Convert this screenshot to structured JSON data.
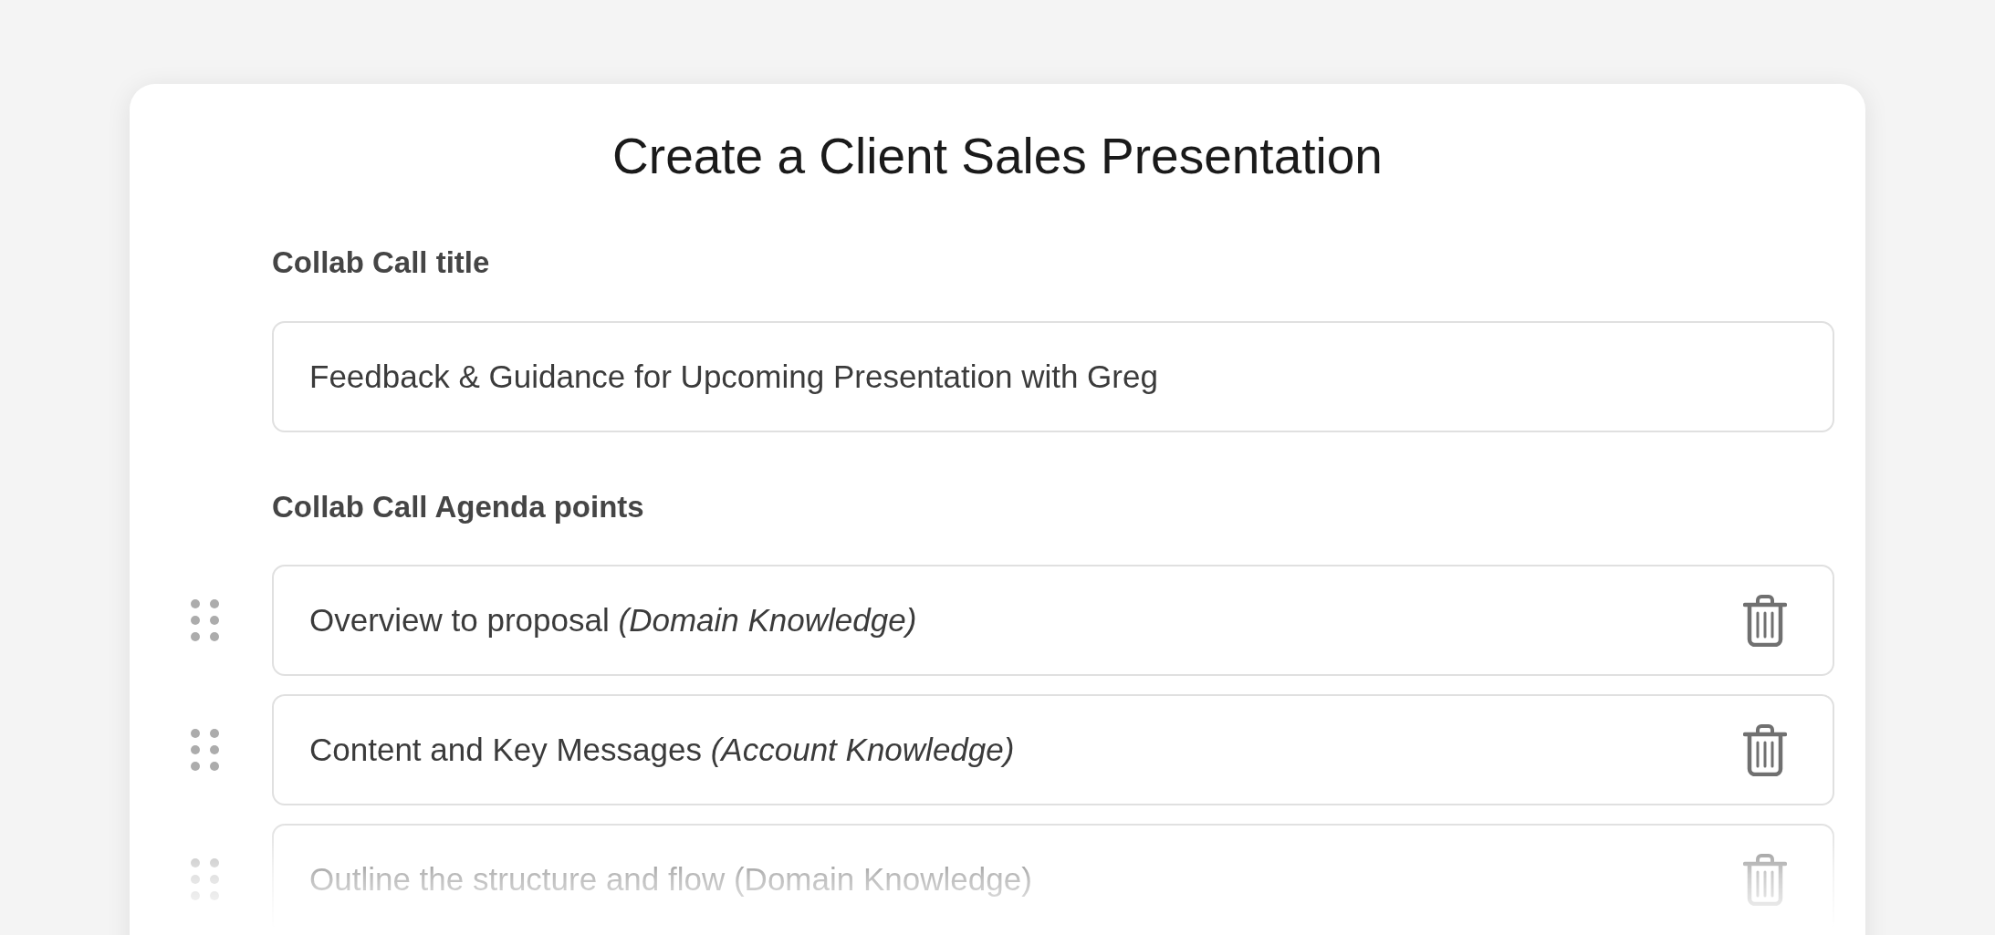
{
  "title": "Create a Client Sales Presentation",
  "call_title": {
    "label": "Collab Call title",
    "value": "Feedback & Guidance for Upcoming Presentation with Greg"
  },
  "agenda": {
    "label": "Collab Call Agenda points",
    "items": [
      {
        "text": "Overview to proposal *(Domain Knowledge)*"
      },
      {
        "text": "Content and Key Messages *(Account Knowledge)*"
      },
      {
        "text": "Outline the structure and flow (Domain Knowledge)"
      }
    ]
  }
}
